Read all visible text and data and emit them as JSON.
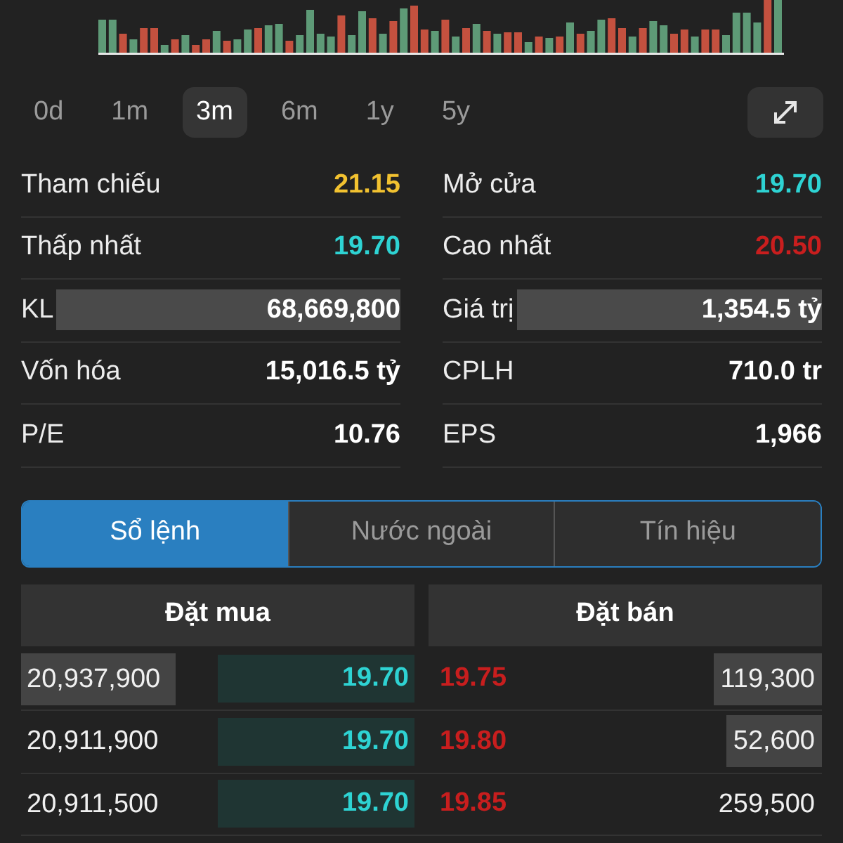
{
  "periods": [
    {
      "label": "0d",
      "selected": false
    },
    {
      "label": "1m",
      "selected": false
    },
    {
      "label": "3m",
      "selected": true
    },
    {
      "label": "6m",
      "selected": false
    },
    {
      "label": "1y",
      "selected": false
    },
    {
      "label": "5y",
      "selected": false
    }
  ],
  "stats": [
    {
      "kind": "plain",
      "label": "Tham chiếu",
      "value": "21.15",
      "color": "#f2c230"
    },
    {
      "kind": "plain",
      "label": "Mở cửa",
      "value": "19.70",
      "color": "#2ed3d3"
    },
    {
      "kind": "plain",
      "label": "Thấp nhất",
      "value": "19.70",
      "color": "#2ed3d3"
    },
    {
      "kind": "plain",
      "label": "Cao nhất",
      "value": "20.50",
      "color": "#c81e1e"
    },
    {
      "kind": "bar",
      "label": "KL",
      "value": "68,669,800"
    },
    {
      "kind": "bar",
      "label": "Giá trị",
      "value": "1,354.5 tỷ"
    },
    {
      "kind": "plain",
      "label": "Vốn hóa",
      "value": "15,016.5 tỷ"
    },
    {
      "kind": "plain",
      "label": "CPLH",
      "value": "710.0 tr"
    },
    {
      "kind": "plain",
      "label": "P/E",
      "value": "10.76"
    },
    {
      "kind": "plain",
      "label": "EPS",
      "value": "1,966"
    }
  ],
  "tabs": [
    {
      "label": "Sổ lệnh",
      "selected": true
    },
    {
      "label": "Nước ngoài",
      "selected": false
    },
    {
      "label": "Tín hiệu",
      "selected": false
    }
  ],
  "order_book": {
    "columns": [
      "Đặt mua",
      "Đặt bán"
    ],
    "rows": [
      {
        "bid_volume": "20,937,900",
        "bid_volume_highlighted": true,
        "bid_price": "19.70",
        "ask_price": "19.75",
        "ask_volume": "119,300",
        "ask_volume_highlighted": true
      },
      {
        "bid_volume": "20,911,900",
        "bid_volume_highlighted": false,
        "bid_price": "19.70",
        "ask_price": "19.80",
        "ask_volume": "52,600",
        "ask_volume_highlighted": true
      },
      {
        "bid_volume": "20,911,500",
        "bid_volume_highlighted": false,
        "bid_price": "19.70",
        "ask_price": "19.85",
        "ask_volume": "259,500",
        "ask_volume_highlighted": false
      }
    ]
  }
}
